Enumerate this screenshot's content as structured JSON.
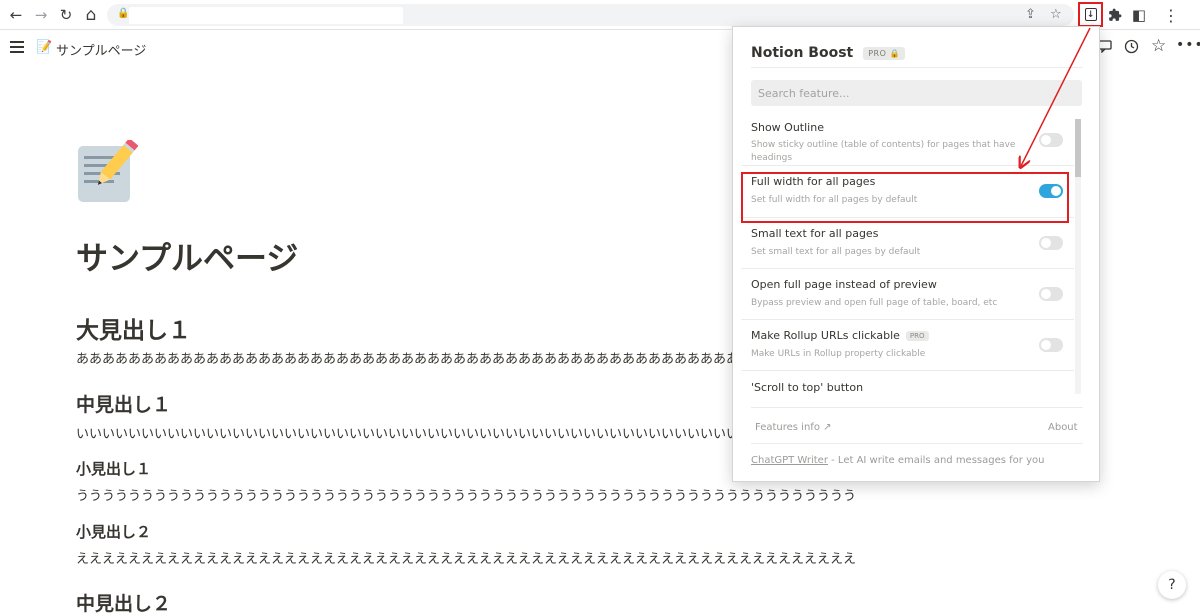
{
  "browser": {
    "back_icon": "←",
    "forward_icon": "→",
    "reload_icon": "↻",
    "home_icon": "⌂",
    "lock_icon": "🔒",
    "url": "",
    "share_icon": "⇪",
    "star_icon": "☆",
    "extensions_icon": "puzzle-icon",
    "sidepanel_icon": "◧",
    "menu_icon": "⋮"
  },
  "notion": {
    "breadcrumb_emoji": "📝",
    "breadcrumb_title": "サンプルページ",
    "page_title": "サンプルページ",
    "blocks": [
      {
        "type": "h1",
        "text": "大見出し１"
      },
      {
        "type": "p",
        "text": "ああああああああああああああああああああああああああああああああああああああああああああああああああああああああああああああ"
      },
      {
        "type": "h2",
        "text": "中見出し１"
      },
      {
        "type": "p",
        "text": "いいいいいいいいいいいいいいいいいいいいいいいいいいいいいいいいいいいいいいいいいいいいいいいいいいいいいいいいいいいいいいいい"
      },
      {
        "type": "h3",
        "text": "小見出し１"
      },
      {
        "type": "p",
        "text": "うううううううううううううううううううううううううううううううううううううううううううううううううううううううううううう"
      },
      {
        "type": "h3",
        "text": "小見出し２"
      },
      {
        "type": "p",
        "text": "ええええええええええええええええええええええええええええええええええええええええええええええええええええええええええええ"
      },
      {
        "type": "h2",
        "text": "中見出し２"
      }
    ],
    "help_label": "?"
  },
  "popup": {
    "title": "Notion Boost",
    "pro_badge": "PRO 🔒",
    "search_placeholder": "Search feature...",
    "features": [
      {
        "title": "Show Outline",
        "pro": "",
        "desc": "Show sticky outline (table of contents) for pages that have headings",
        "enabled": false
      },
      {
        "title": "Full width for all pages",
        "pro": "",
        "desc": "Set full width for all pages by default",
        "enabled": true
      },
      {
        "title": "Small text for all pages",
        "pro": "",
        "desc": "Set small text for all pages by default",
        "enabled": false
      },
      {
        "title": "Open full page instead of preview",
        "pro": "",
        "desc": "Bypass preview and open full page of table, board, etc",
        "enabled": false
      },
      {
        "title": "Make Rollup URLs clickable",
        "pro": "PRO",
        "desc": "Make URLs in Rollup property clickable",
        "enabled": false
      },
      {
        "title": "'Scroll to top' button",
        "pro": "",
        "desc": "",
        "enabled": false
      }
    ],
    "features_info": "Features info ↗",
    "about": "About",
    "writer_link": "ChatGPT Writer",
    "writer_text": " - Let AI write emails and messages for you"
  },
  "colors": {
    "highlight": "#e02020",
    "toggle_on": "#2ea6dd",
    "toggle_off": "#e3e3e3"
  }
}
